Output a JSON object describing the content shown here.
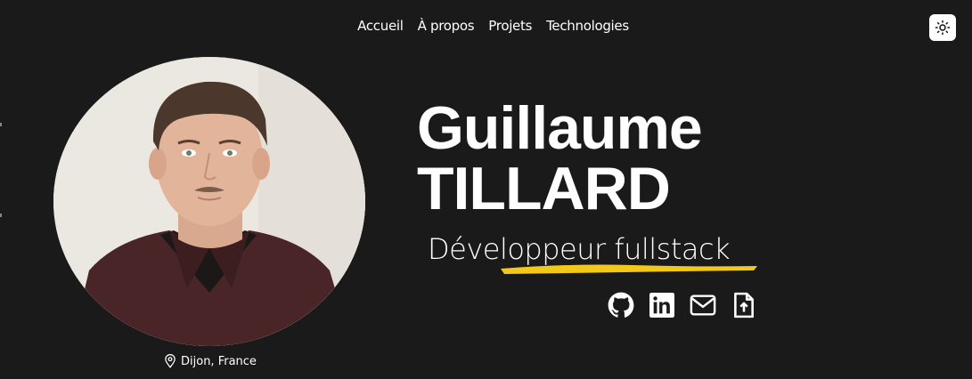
{
  "nav": {
    "items": [
      {
        "label": "Accueil"
      },
      {
        "label": "À propos"
      },
      {
        "label": "Projets"
      },
      {
        "label": "Technologies"
      }
    ],
    "theme_toggle_icon": "sun-icon"
  },
  "hero": {
    "name_first": "Guillaume",
    "name_last": "TILLARD",
    "role": "Développeur fullstack",
    "location": "Dijon, France",
    "accent_color": "#f2c81a",
    "background_color": "#1b1a1a"
  },
  "socials": [
    {
      "icon": "github-icon"
    },
    {
      "icon": "linkedin-icon"
    },
    {
      "icon": "mail-icon"
    },
    {
      "icon": "resume-upload-icon"
    }
  ]
}
